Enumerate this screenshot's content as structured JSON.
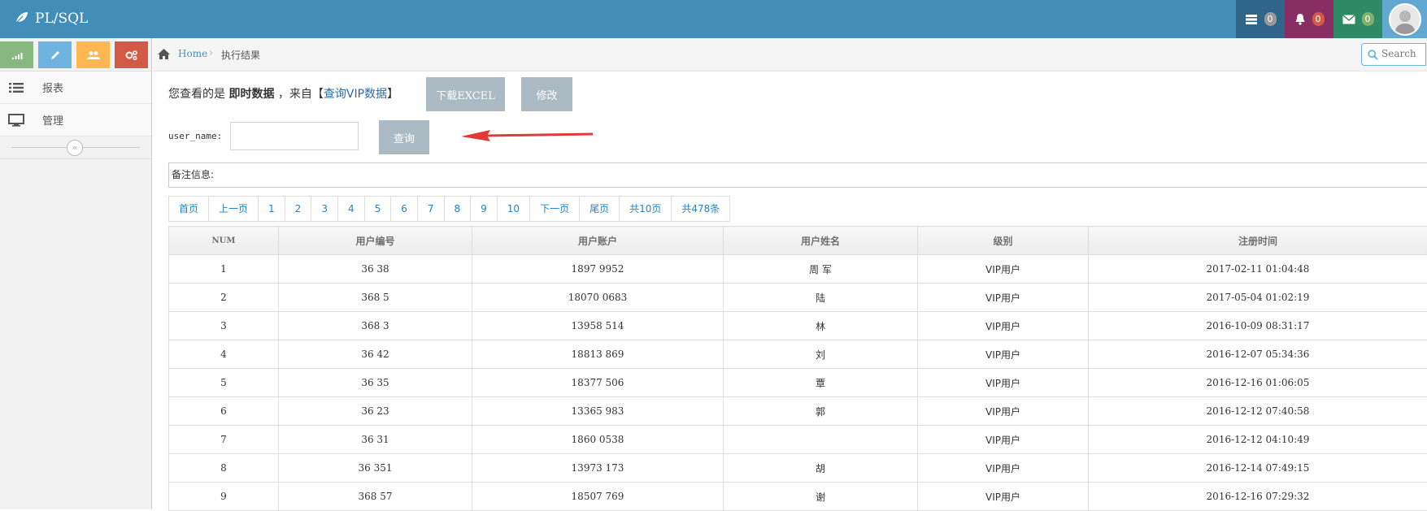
{
  "navbar": {
    "brand": "PL/SQL",
    "tasks_count": "0",
    "notifications_count": "0",
    "messages_count": "0",
    "colors": {
      "bg": "#438eb9",
      "tasks": "#2e6589",
      "bell": "#892e65",
      "mail": "#2e8965"
    }
  },
  "sidebar": {
    "shortcuts": [
      {
        "icon": "signal-icon",
        "color": "#87b87f"
      },
      {
        "icon": "pencil-icon",
        "color": "#6fb3e0"
      },
      {
        "icon": "users-icon",
        "color": "#ffb752"
      },
      {
        "icon": "cogs-icon",
        "color": "#d15b47"
      }
    ],
    "items": [
      {
        "label": "报表",
        "icon": "list-icon"
      },
      {
        "label": "管理",
        "icon": "desktop-icon"
      }
    ],
    "collapse_glyph": "«"
  },
  "breadcrumb": {
    "home": "Home",
    "separator": "›",
    "current": "执行结果"
  },
  "search": {
    "placeholder": "Search"
  },
  "info": {
    "prefix": "您查看的是",
    "mode": "即时数据",
    "from": "，来自",
    "bracket_open": "【",
    "source_link": "查询VIP数据",
    "bracket_close": "】"
  },
  "buttons": {
    "download": "下载EXCEL",
    "edit": "修改",
    "query": "查询"
  },
  "filter": {
    "label": "user_name:",
    "value": ""
  },
  "remark": {
    "label": "备注信息:"
  },
  "pager": [
    "首页",
    "上一页",
    "1",
    "2",
    "3",
    "4",
    "5",
    "6",
    "7",
    "8",
    "9",
    "10",
    "下一页",
    "尾页",
    "共10页",
    "共478条"
  ],
  "table": {
    "columns": [
      "NUM",
      "用户编号",
      "用户账户",
      "用户姓名",
      "级别",
      "注册时间"
    ],
    "rows": [
      [
        "1",
        "36  38",
        "1897  9952",
        "周  军",
        "VIP用户",
        "2017-02-11 01:04:48"
      ],
      [
        "2",
        "368  5",
        "18070  0683",
        "陆  ",
        "VIP用户",
        "2017-05-04 01:02:19"
      ],
      [
        "3",
        "368  3",
        "13958  514",
        "林  ",
        "VIP用户",
        "2016-10-09 08:31:17"
      ],
      [
        "4",
        "36  42",
        "18813  869",
        "刘  ",
        "VIP用户",
        "2016-12-07 05:34:36"
      ],
      [
        "5",
        "36  35",
        "18377  506",
        "覃  ",
        "VIP用户",
        "2016-12-16 01:06:05"
      ],
      [
        "6",
        "36  23",
        "13365  983",
        "郭  ",
        "VIP用户",
        "2016-12-12 07:40:58"
      ],
      [
        "7",
        "36  31",
        "1860  0538",
        "  ",
        "VIP用户",
        "2016-12-12 04:10:49"
      ],
      [
        "8",
        "36  351",
        "13973  173",
        "胡  ",
        "VIP用户",
        "2016-12-14 07:49:15"
      ],
      [
        "9",
        "368  57",
        "18507  769",
        "谢  ",
        "VIP用户",
        "2016-12-16 07:29:32"
      ]
    ]
  }
}
